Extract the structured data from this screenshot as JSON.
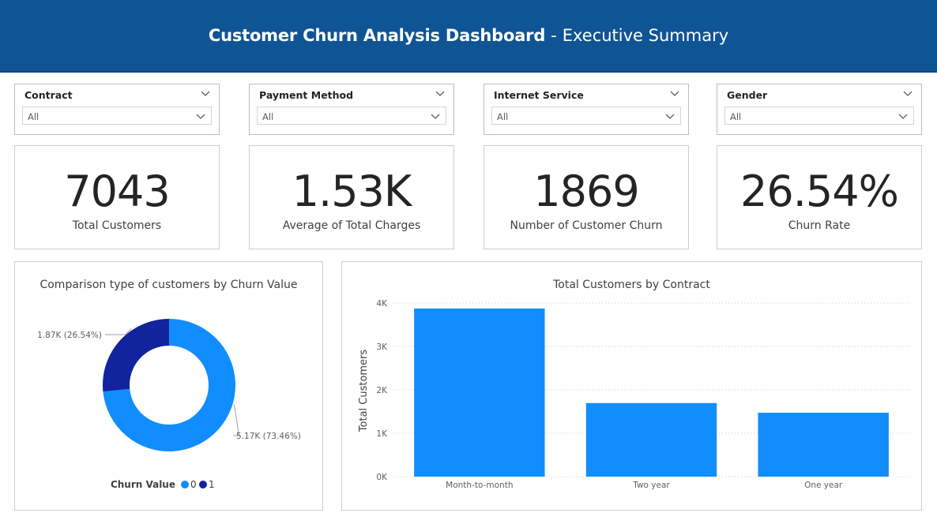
{
  "header": {
    "title": "Customer Churn Analysis Dashboard",
    "separator": "-",
    "subtitle": "Executive Summary"
  },
  "slicers": [
    {
      "label": "Contract",
      "value": "All"
    },
    {
      "label": "Payment Method",
      "value": "All"
    },
    {
      "label": "Internet Service",
      "value": "All"
    },
    {
      "label": "Gender",
      "value": "All"
    }
  ],
  "cards": [
    {
      "value": "7043",
      "label": "Total Customers"
    },
    {
      "value": "1.53K",
      "label": "Average of Total Charges"
    },
    {
      "value": "1869",
      "label": "Number of Customer Churn"
    },
    {
      "value": "26.54%",
      "label": "Churn Rate"
    }
  ],
  "icons": {
    "slicer_chevron": "chevron-down-icon",
    "dropdown_chevron": "chevron-down-icon"
  },
  "colors": {
    "header": "#0f5596",
    "series_0": "#118dff",
    "series_1": "#12239e"
  },
  "chart_data": [
    {
      "type": "pie",
      "title": "Comparison type of customers by Churn Value",
      "legend_title": "Churn Value",
      "legend_placement": "bottom",
      "slices": [
        {
          "name": "0",
          "value": 5174,
          "label": "5.17K (73.46%)"
        },
        {
          "name": "1",
          "value": 1869,
          "label": "1.87K (26.54%)"
        }
      ]
    },
    {
      "type": "bar",
      "title": "Total Customers by Contract",
      "xlabel": "",
      "ylabel": "Total Customers",
      "categories": [
        "Month-to-month",
        "Two year",
        "One year"
      ],
      "values": [
        3875,
        1695,
        1473
      ],
      "ylim": [
        0,
        4000
      ],
      "yticks": [
        0,
        1000,
        2000,
        3000,
        4000
      ],
      "ytick_labels": [
        "0K",
        "1K",
        "2K",
        "3K",
        "4K"
      ],
      "grid": true
    }
  ]
}
